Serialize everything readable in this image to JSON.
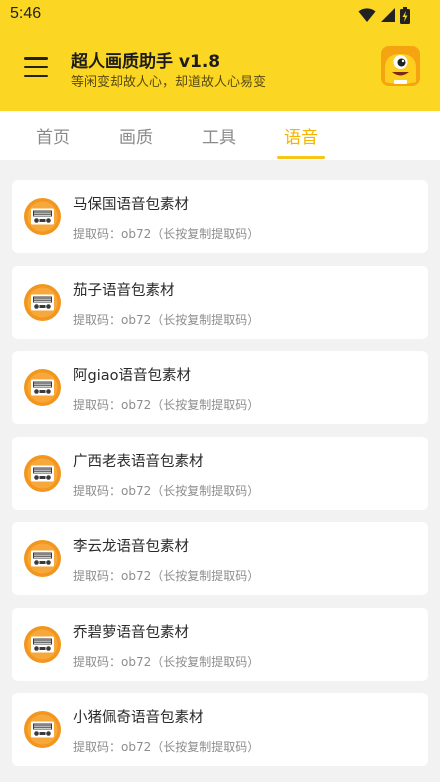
{
  "status_bar": {
    "time": "5:46",
    "icons": [
      "wifi-icon",
      "signal-icon",
      "battery-charging-icon"
    ]
  },
  "header": {
    "menu_icon": "hamburger-menu-icon",
    "title": "超人画质助手 v1.8",
    "subtitle": "等闲变却故人心，却道故人心易变",
    "avatar_icon": "yellow-monster-avatar-icon"
  },
  "colors": {
    "header_bg": "#fbd723",
    "accent": "#f5b400",
    "icon_orange": "#f2961e"
  },
  "tabs": [
    {
      "label": "首页",
      "active": false
    },
    {
      "label": "画质",
      "active": false
    },
    {
      "label": "工具",
      "active": false
    },
    {
      "label": "语音",
      "active": true
    }
  ],
  "list": {
    "item_icon": "radio-cassette-icon",
    "items": [
      {
        "title": "马保国语音包素材",
        "code": "提取码：ob72（长按复制提取码）"
      },
      {
        "title": "茄子语音包素材",
        "code": "提取码：ob72（长按复制提取码）"
      },
      {
        "title": "阿giao语音包素材",
        "code": "提取码：ob72（长按复制提取码）"
      },
      {
        "title": "广西老表语音包素材",
        "code": "提取码：ob72（长按复制提取码）"
      },
      {
        "title": "李云龙语音包素材",
        "code": "提取码：ob72（长按复制提取码）"
      },
      {
        "title": "乔碧萝语音包素材",
        "code": "提取码：ob72（长按复制提取码）"
      },
      {
        "title": "小猪佩奇语音包素材",
        "code": "提取码：ob72（长按复制提取码）"
      }
    ]
  }
}
